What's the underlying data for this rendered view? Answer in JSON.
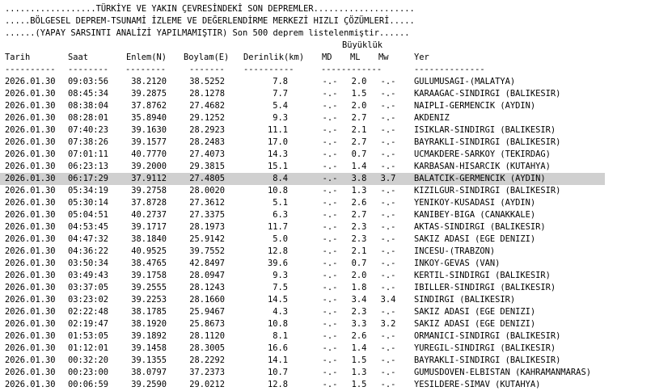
{
  "header": {
    "line1": "..................TÜRKİYE VE YAKIN ÇEVRESİNDEKİ SON DEPREMLER....................",
    "line2": ".....BÖLGESEL DEPREM-TSUNAMİ İZLEME VE DEĞERLENDİRME MERKEZİ HIZLI ÇÖZÜMLERİ.....",
    "line3": "......(YAPAY SARSINTI ANALİZİ YAPILMAMIŞTIR) Son 500 deprem listelenmiştir......",
    "buyukluk": "Büyüklük"
  },
  "columns": {
    "tarih": "Tarih",
    "saat": "Saat",
    "enlem": "Enlem(N)",
    "boylam": "Boylam(E)",
    "derinlik": "Derinlik(km)",
    "md": "MD",
    "ml": "ML",
    "mw": "Mw",
    "yer": "Yer"
  },
  "separators": {
    "tarih": "----------",
    "saat": "--------",
    "enlem": "--------",
    "boylam": "-------",
    "derinlik": "----------",
    "mag": "------------",
    "yer": "--------------"
  },
  "rows": [
    {
      "tarih": "2026.01.30",
      "saat": "09:03:56",
      "enlem": "38.2120",
      "boylam": "38.5252",
      "derinlik": "7.8",
      "md": "-.-",
      "ml": "2.0",
      "mw": "-.-",
      "yer": "GULUMUSAGI-(MALATYA)"
    },
    {
      "tarih": "2026.01.30",
      "saat": "08:45:34",
      "enlem": "39.2875",
      "boylam": "28.1278",
      "derinlik": "7.7",
      "md": "-.-",
      "ml": "1.5",
      "mw": "-.-",
      "yer": "KARAAGAC-SINDIRGI (BALIKESIR)"
    },
    {
      "tarih": "2026.01.30",
      "saat": "08:38:04",
      "enlem": "37.8762",
      "boylam": "27.4682",
      "derinlik": "5.4",
      "md": "-.-",
      "ml": "2.0",
      "mw": "-.-",
      "yer": "NAIPLI-GERMENCIK (AYDIN)"
    },
    {
      "tarih": "2026.01.30",
      "saat": "08:28:01",
      "enlem": "35.8940",
      "boylam": "29.1252",
      "derinlik": "9.3",
      "md": "-.-",
      "ml": "2.7",
      "mw": "-.-",
      "yer": "AKDENIZ"
    },
    {
      "tarih": "2026.01.30",
      "saat": "07:40:23",
      "enlem": "39.1630",
      "boylam": "28.2923",
      "derinlik": "11.1",
      "md": "-.-",
      "ml": "2.1",
      "mw": "-.-",
      "yer": "ISIKLAR-SINDIRGI (BALIKESIR)"
    },
    {
      "tarih": "2026.01.30",
      "saat": "07:38:26",
      "enlem": "39.1577",
      "boylam": "28.2483",
      "derinlik": "17.0",
      "md": "-.-",
      "ml": "2.7",
      "mw": "-.-",
      "yer": "BAYRAKLI-SINDIRGI (BALIKESIR)"
    },
    {
      "tarih": "2026.01.30",
      "saat": "07:01:11",
      "enlem": "40.7770",
      "boylam": "27.4073",
      "derinlik": "14.3",
      "md": "-.-",
      "ml": "0.7",
      "mw": "-.-",
      "yer": "UCMAKDERE-SARKOY (TEKIRDAG)"
    },
    {
      "tarih": "2026.01.30",
      "saat": "06:23:13",
      "enlem": "39.2000",
      "boylam": "29.3815",
      "derinlik": "15.1",
      "md": "-.-",
      "ml": "1.4",
      "mw": "-.-",
      "yer": "KARBASAN-HISARCIK (KUTAHYA)"
    },
    {
      "tarih": "2026.01.30",
      "saat": "06:17:29",
      "enlem": "37.9112",
      "boylam": "27.4805",
      "derinlik": "8.4",
      "md": "-.-",
      "ml": "3.8",
      "mw": "3.7",
      "yer": "BALATCIK-GERMENCIK (AYDIN)",
      "highlight": true
    },
    {
      "tarih": "2026.01.30",
      "saat": "05:34:19",
      "enlem": "39.2758",
      "boylam": "28.0020",
      "derinlik": "10.8",
      "md": "-.-",
      "ml": "1.3",
      "mw": "-.-",
      "yer": "KIZILGUR-SINDIRGI (BALIKESIR)"
    },
    {
      "tarih": "2026.01.30",
      "saat": "05:30:14",
      "enlem": "37.8728",
      "boylam": "27.3612",
      "derinlik": "5.1",
      "md": "-.-",
      "ml": "2.6",
      "mw": "-.-",
      "yer": "YENIKOY-KUSADASI (AYDIN)"
    },
    {
      "tarih": "2026.01.30",
      "saat": "05:04:51",
      "enlem": "40.2737",
      "boylam": "27.3375",
      "derinlik": "6.3",
      "md": "-.-",
      "ml": "2.7",
      "mw": "-.-",
      "yer": "KANIBEY-BIGA (CANAKKALE)"
    },
    {
      "tarih": "2026.01.30",
      "saat": "04:53:45",
      "enlem": "39.1717",
      "boylam": "28.1973",
      "derinlik": "11.7",
      "md": "-.-",
      "ml": "2.3",
      "mw": "-.-",
      "yer": "AKTAS-SINDIRGI (BALIKESIR)"
    },
    {
      "tarih": "2026.01.30",
      "saat": "04:47:32",
      "enlem": "38.1840",
      "boylam": "25.9142",
      "derinlik": "5.0",
      "md": "-.-",
      "ml": "2.3",
      "mw": "-.-",
      "yer": "SAKIZ ADASI (EGE DENIZI)"
    },
    {
      "tarih": "2026.01.30",
      "saat": "04:36:22",
      "enlem": "40.9525",
      "boylam": "39.7552",
      "derinlik": "12.8",
      "md": "-.-",
      "ml": "2.1",
      "mw": "-.-",
      "yer": "INCESU-(TRABZON)"
    },
    {
      "tarih": "2026.01.30",
      "saat": "03:50:34",
      "enlem": "38.4765",
      "boylam": "42.8497",
      "derinlik": "39.6",
      "md": "-.-",
      "ml": "0.7",
      "mw": "-.-",
      "yer": "INKOY-GEVAS (VAN)"
    },
    {
      "tarih": "2026.01.30",
      "saat": "03:49:43",
      "enlem": "39.1758",
      "boylam": "28.0947",
      "derinlik": "9.3",
      "md": "-.-",
      "ml": "2.0",
      "mw": "-.-",
      "yer": "KERTIL-SINDIRGI (BALIKESIR)"
    },
    {
      "tarih": "2026.01.30",
      "saat": "03:37:05",
      "enlem": "39.2555",
      "boylam": "28.1243",
      "derinlik": "7.5",
      "md": "-.-",
      "ml": "1.8",
      "mw": "-.-",
      "yer": "IBILLER-SINDIRGI (BALIKESIR)"
    },
    {
      "tarih": "2026.01.30",
      "saat": "03:23:02",
      "enlem": "39.2253",
      "boylam": "28.1660",
      "derinlik": "14.5",
      "md": "-.-",
      "ml": "3.4",
      "mw": "3.4",
      "yer": "SINDIRGI (BALIKESIR)"
    },
    {
      "tarih": "2026.01.30",
      "saat": "02:22:48",
      "enlem": "38.1785",
      "boylam": "25.9467",
      "derinlik": "4.3",
      "md": "-.-",
      "ml": "2.3",
      "mw": "-.-",
      "yer": "SAKIZ ADASI (EGE DENIZI)"
    },
    {
      "tarih": "2026.01.30",
      "saat": "02:19:47",
      "enlem": "38.1920",
      "boylam": "25.8673",
      "derinlik": "10.8",
      "md": "-.-",
      "ml": "3.3",
      "mw": "3.2",
      "yer": "SAKIZ ADASI (EGE DENIZI)"
    },
    {
      "tarih": "2026.01.30",
      "saat": "01:53:05",
      "enlem": "39.1892",
      "boylam": "28.1120",
      "derinlik": "8.1",
      "md": "-.-",
      "ml": "2.6",
      "mw": "-.-",
      "yer": "ORMANICI-SINDIRGI (BALIKESIR)"
    },
    {
      "tarih": "2026.01.30",
      "saat": "01:12:01",
      "enlem": "39.1458",
      "boylam": "28.3005",
      "derinlik": "16.6",
      "md": "-.-",
      "ml": "1.4",
      "mw": "-.-",
      "yer": "YUREGIL-SINDIRGI (BALIKESIR)"
    },
    {
      "tarih": "2026.01.30",
      "saat": "00:32:20",
      "enlem": "39.1355",
      "boylam": "28.2292",
      "derinlik": "14.1",
      "md": "-.-",
      "ml": "1.5",
      "mw": "-.-",
      "yer": "BAYRAKLI-SINDIRGI (BALIKESIR)"
    },
    {
      "tarih": "2026.01.30",
      "saat": "00:23:00",
      "enlem": "38.0797",
      "boylam": "37.2373",
      "derinlik": "10.7",
      "md": "-.-",
      "ml": "1.3",
      "mw": "-.-",
      "yer": "GUMUSDOVEN-ELBISTAN (KAHRAMANMARAS)"
    },
    {
      "tarih": "2026.01.30",
      "saat": "00:06:59",
      "enlem": "39.2590",
      "boylam": "29.0212",
      "derinlik": "12.8",
      "md": "-.-",
      "ml": "1.5",
      "mw": "-.-",
      "yer": "YESILDERE-SIMAV (KUTAHYA)"
    }
  ]
}
